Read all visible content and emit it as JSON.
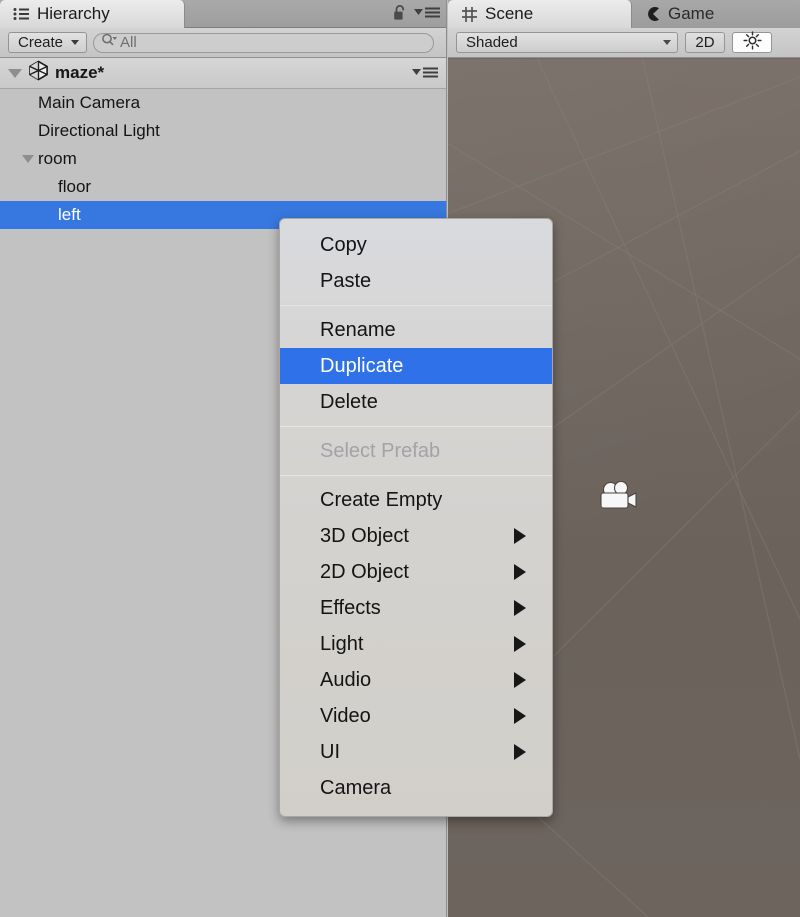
{
  "hierarchy": {
    "tab_label": "Hierarchy",
    "tab_icon": "list-icon",
    "lock_icon": "padlock-icon",
    "options_icon": "panel-options-icon",
    "toolbar": {
      "create_label": "Create",
      "create_caret_icon": "chevron-down-icon",
      "search_icon": "search-icon",
      "search_value": "All",
      "search_placeholder": "All"
    },
    "scene_root": {
      "name": "maze*",
      "unity_icon": "unity-logo-icon",
      "twisty_icon": "triangle-down-icon",
      "options_icon": "panel-options-icon",
      "expanded": true
    },
    "tree": [
      {
        "label": "Main Camera",
        "depth": 1,
        "expandable": false,
        "selected": false
      },
      {
        "label": "Directional Light",
        "depth": 1,
        "expandable": false,
        "selected": false
      },
      {
        "label": "room",
        "depth": 1,
        "expandable": true,
        "selected": false
      },
      {
        "label": "floor",
        "depth": 2,
        "expandable": false,
        "selected": false
      },
      {
        "label": "left",
        "depth": 2,
        "expandable": false,
        "selected": true
      }
    ]
  },
  "scene": {
    "tabs": [
      {
        "label": "Scene",
        "icon": "grid-hash-icon",
        "active": true
      },
      {
        "label": "Game",
        "icon": "pacman-icon",
        "active": false
      }
    ],
    "toolbar": {
      "draw_mode": "Shaded",
      "draw_mode_caret_icon": "chevron-down-icon",
      "toggle_2d_label": "2D",
      "lighting_icon": "sun-icon",
      "lighting_active": true
    },
    "viewport": {
      "camera_gizmo_icon": "movie-camera-icon",
      "background_color": "#6f6660",
      "grid_line_color": "#8b8279"
    }
  },
  "context_menu": {
    "groups": [
      {
        "items": [
          {
            "label": "Copy",
            "submenu": false,
            "disabled": false,
            "highlighted": false
          },
          {
            "label": "Paste",
            "submenu": false,
            "disabled": false,
            "highlighted": false
          }
        ]
      },
      {
        "items": [
          {
            "label": "Rename",
            "submenu": false,
            "disabled": false,
            "highlighted": false
          },
          {
            "label": "Duplicate",
            "submenu": false,
            "disabled": false,
            "highlighted": true
          },
          {
            "label": "Delete",
            "submenu": false,
            "disabled": false,
            "highlighted": false
          }
        ]
      },
      {
        "items": [
          {
            "label": "Select Prefab",
            "submenu": false,
            "disabled": true,
            "highlighted": false
          }
        ]
      },
      {
        "items": [
          {
            "label": "Create Empty",
            "submenu": false,
            "disabled": false,
            "highlighted": false
          },
          {
            "label": "3D Object",
            "submenu": true,
            "disabled": false,
            "highlighted": false
          },
          {
            "label": "2D Object",
            "submenu": true,
            "disabled": false,
            "highlighted": false
          },
          {
            "label": "Effects",
            "submenu": true,
            "disabled": false,
            "highlighted": false
          },
          {
            "label": "Light",
            "submenu": true,
            "disabled": false,
            "highlighted": false
          },
          {
            "label": "Audio",
            "submenu": true,
            "disabled": false,
            "highlighted": false
          },
          {
            "label": "Video",
            "submenu": true,
            "disabled": false,
            "highlighted": false
          },
          {
            "label": "UI",
            "submenu": true,
            "disabled": false,
            "highlighted": false
          },
          {
            "label": "Camera",
            "submenu": false,
            "disabled": false,
            "highlighted": false
          }
        ]
      }
    ]
  },
  "colors": {
    "selection_blue": "#3778e0",
    "menu_highlight_blue": "#2f71e8",
    "panel_gray": "#c2c2c2",
    "scene_bg": "#6f6660"
  }
}
